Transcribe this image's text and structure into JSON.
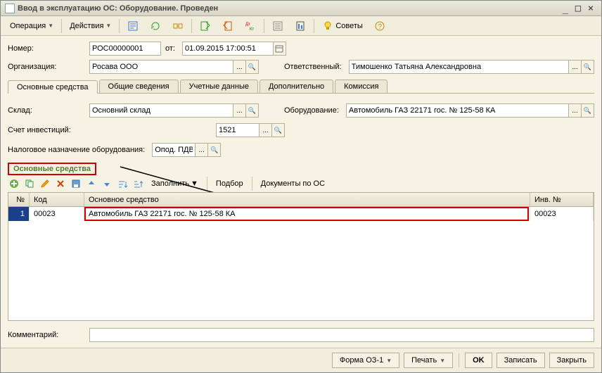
{
  "window": {
    "title": "Ввод в эксплуатацию ОС: Оборудование. Проведен"
  },
  "toolbar": {
    "operation": "Операция",
    "actions": "Действия",
    "tips": "Советы"
  },
  "fields": {
    "number_label": "Номер:",
    "number": "РОС00000001",
    "date_label": "от:",
    "date": "01.09.2015 17:00:51",
    "org_label": "Организация:",
    "org": "Росава ООО",
    "resp_label": "Ответственный:",
    "resp": "Тимошенко Татьяна Александровна",
    "warehouse_label": "Склад:",
    "warehouse": "Основний склад",
    "equipment_label": "Оборудование:",
    "equipment": "Автомобиль ГАЗ 22171 гос. № 125-58 КА",
    "invacc_label": "Счет инвестиций:",
    "invacc": "1521",
    "tax_label": "Налоговое назначение оборудования:",
    "tax": "Опод. ПДВ",
    "comment_label": "Комментарий:",
    "comment": ""
  },
  "tabs": {
    "t1": "Основные средства",
    "t2": "Общие сведения",
    "t3": "Учетные данные",
    "t4": "Дополнительно",
    "t5": "Комиссия"
  },
  "section": {
    "title": "Основные средства"
  },
  "gridtoolbar": {
    "fill": "Заполнить",
    "pick": "Подбор",
    "docs": "Документы по ОС"
  },
  "grid": {
    "col_n": "№",
    "col_kod": "Код",
    "col_os": "Основное средство",
    "col_inv": "Инв. №",
    "rows": [
      {
        "n": "1",
        "kod": "00023",
        "os": "Автомобиль ГАЗ 22171 гос. № 125-58 КА",
        "inv": "00023"
      }
    ]
  },
  "footer": {
    "form": "Форма ОЗ-1",
    "print": "Печать",
    "ok": "OK",
    "save": "Записать",
    "close": "Закрыть"
  }
}
